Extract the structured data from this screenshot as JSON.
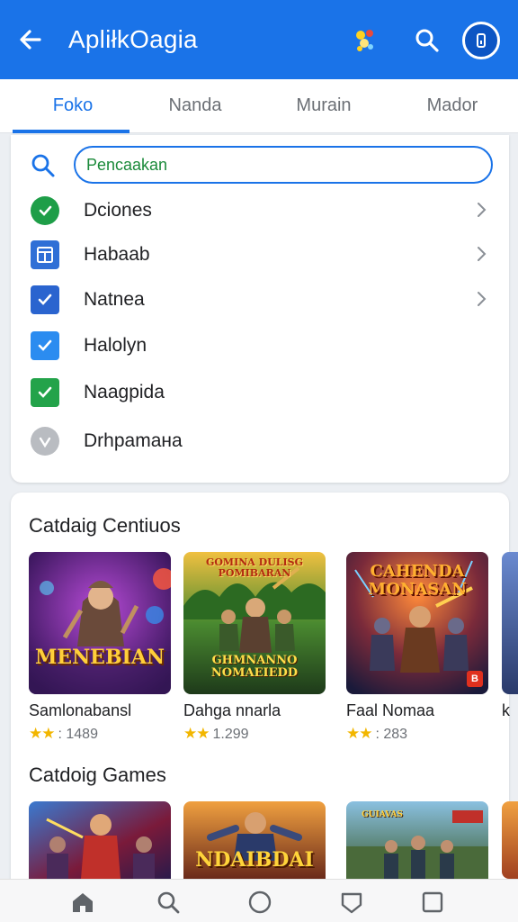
{
  "app_bar": {
    "title": "ApliłkOagia",
    "icons": [
      "back-arrow-icon",
      "colored-dots-icon",
      "search-icon",
      "profile-icon"
    ],
    "color": "#1a73e8"
  },
  "tabs": [
    {
      "label": "Foko",
      "active": true
    },
    {
      "label": "Nanda",
      "active": false
    },
    {
      "label": "Murain",
      "active": false
    },
    {
      "label": "Mador",
      "active": false
    }
  ],
  "search": {
    "placeholder": "Pencaakan",
    "value": ""
  },
  "menu": [
    {
      "label": "Dciones",
      "icon": "green-circle-icon",
      "chevron": true
    },
    {
      "label": "Habaab",
      "icon": "window-icon",
      "chevron": true
    },
    {
      "label": "Natnea",
      "icon": "checkbox-checked-icon",
      "chevron": true
    },
    {
      "label": "Halolyn",
      "icon": "checkbox-checked-light-icon",
      "chevron": false
    },
    {
      "label": "Naagpida",
      "icon": "green-check-icon",
      "chevron": false
    },
    {
      "label": "Drhpamaнa",
      "icon": "grey-circle-check-icon",
      "chevron": false
    }
  ],
  "section1": {
    "title": "Catdaig Centiuos",
    "games": [
      {
        "name": "Samlonabansl",
        "stars": "★★",
        "rating": ": 1489",
        "art_text": "MENEBIAN"
      },
      {
        "name": "Dahga nnarla",
        "stars": "★★",
        "rating": "1.299",
        "art_text_top": "GOMINA DULISG POMIBARAN",
        "art_text": "GHMNANNO NOMAEIEDD"
      },
      {
        "name": "Faal Nomaa",
        "stars": "★★",
        "rating": ": 283",
        "art_text": "CAHENDA MONASAN",
        "badge": "B"
      }
    ],
    "peek_label": "k"
  },
  "section2": {
    "title": "Catdoig Games",
    "games": [
      {
        "name": "",
        "art_text": ""
      },
      {
        "name": "",
        "art_text": "NDAIBDAI"
      },
      {
        "name": "",
        "art_text": "GUIAVAS"
      }
    ]
  },
  "bottom_nav": [
    "home-icon",
    "search-icon",
    "circle-icon",
    "shield-icon",
    "square-icon"
  ],
  "colors": {
    "primary": "#1a73e8",
    "green": "#1e9e48",
    "star": "#f2b600"
  }
}
